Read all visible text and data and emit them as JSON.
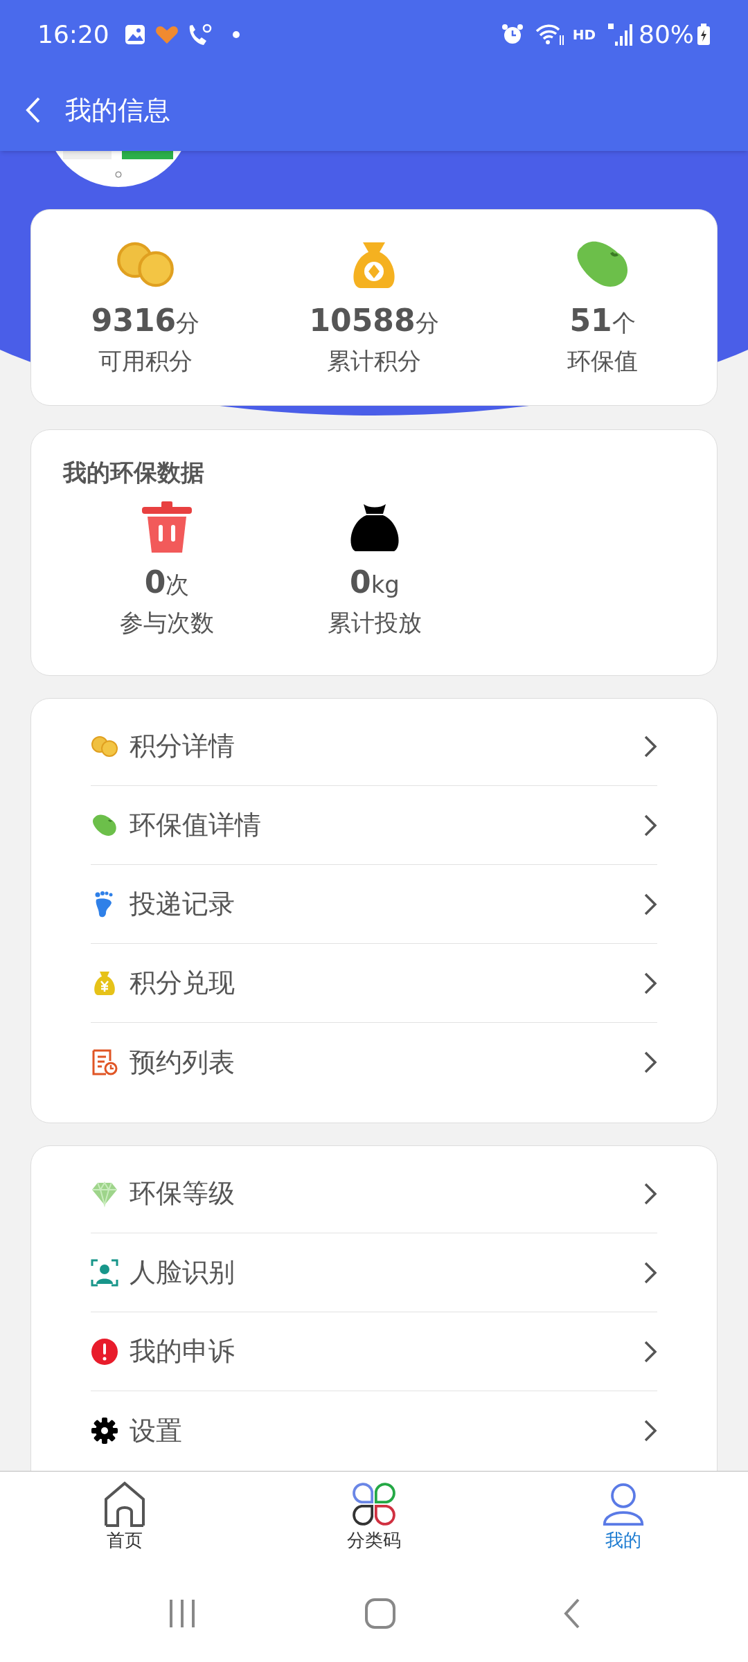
{
  "status_bar": {
    "time": "16:20",
    "network": "HD",
    "battery": "80%"
  },
  "header": {
    "title": "我的信息"
  },
  "profile": {
    "avatar": {
      "kind": "picture"
    }
  },
  "summary": [
    {
      "kind": "coins",
      "value": "9316",
      "unit": "分",
      "label": "可用积分"
    },
    {
      "kind": "bag",
      "value": "10588",
      "unit": "分",
      "label": "累计积分"
    },
    {
      "kind": "bean",
      "value": "51",
      "unit": "个",
      "label": "环保值"
    }
  ],
  "eco_data": {
    "title": "我的环保数据",
    "items": [
      {
        "kind": "trash",
        "value": "0",
        "unit": "次",
        "label": "参与次数"
      },
      {
        "kind": "sack",
        "value": "0",
        "unit": "kg",
        "label": "累计投放"
      }
    ]
  },
  "menu_groups": [
    [
      {
        "kind": "coins",
        "label": "积分详情"
      },
      {
        "kind": "bean",
        "label": "环保值详情"
      },
      {
        "kind": "foot",
        "label": "投递记录"
      },
      {
        "kind": "money",
        "label": "积分兑现"
      },
      {
        "kind": "list",
        "label": "预约列表"
      }
    ],
    [
      {
        "kind": "diamond",
        "label": "环保等级"
      },
      {
        "kind": "face",
        "label": "人脸识别"
      },
      {
        "kind": "alert",
        "label": "我的申诉"
      },
      {
        "kind": "gear",
        "label": "设置"
      }
    ]
  ],
  "bottom_nav": [
    {
      "kind": "home",
      "label": "首页",
      "selected": false
    },
    {
      "kind": "clover",
      "label": "分类码",
      "selected": false
    },
    {
      "kind": "person",
      "label": "我的",
      "selected": true
    }
  ]
}
